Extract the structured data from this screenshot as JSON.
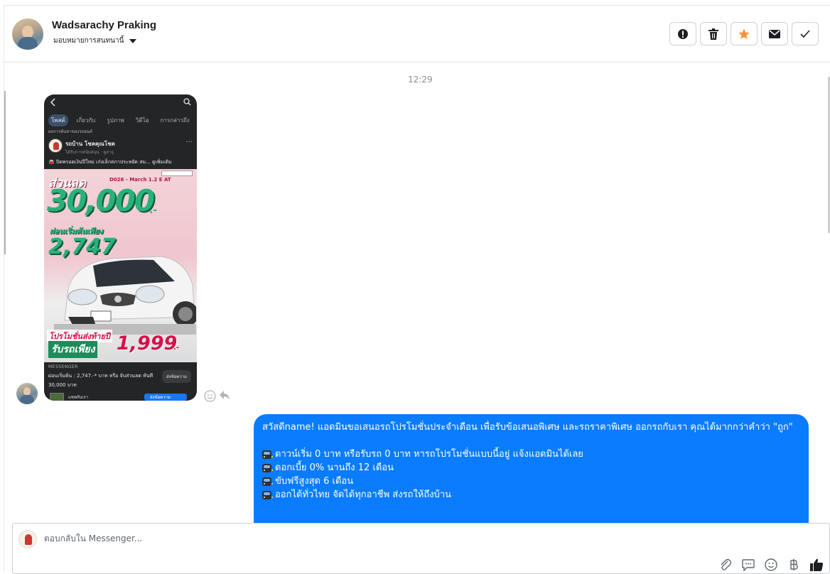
{
  "header": {
    "contact_name": "Wadsarachy Praking",
    "assign_label": "มอบหมายการสนทนานี้",
    "actions": [
      {
        "icon": "alert-icon"
      },
      {
        "icon": "trash-icon"
      },
      {
        "icon": "star-icon",
        "color": "#f7923a"
      },
      {
        "icon": "envelope-icon"
      },
      {
        "icon": "check-icon"
      }
    ]
  },
  "timestamp": "12:29",
  "incoming_post": {
    "tabs": [
      "โพสต์",
      "เกี่ยวกับ",
      "รูปภาพ",
      "วิดีโอ",
      "การกล่าวถึง"
    ],
    "subheader": "ผลการค้นหาของรถยนต์",
    "page_name": "รถบ้าน โชคคุณโชค",
    "page_meta": "ได้รับการสนับสนุน · ดูสาธุ",
    "caption": "🚘 ปิดพรอดเงินปีใหม่ เก๋งเล็กสภาประหยัด สม... ดูเพิ่มเติม",
    "ad": {
      "headline": "ส่วนลด",
      "code": "D026 - March 1.2 E AT",
      "discount": "30,000",
      "discount_suffix": ".-",
      "installment_label": "ผ่อนเริ่มต้นเพียง",
      "installment": "2,747",
      "promo_label": "โปรโมชั่นส่งท้ายปี",
      "pickup_label": "รับรถเพียง",
      "price": "1,999",
      "price_suffix": ".-"
    },
    "messenger_label": "MESSENGER",
    "messenger_text": "ผ่อนเริ่มต้น : 2,747.-* บาท หรือ จับส่วนลด ทันที 30,000 บาท",
    "send_button": "ส่งข้อความ",
    "bottom_name": "แชทกับเรา",
    "bottom_button": "ส่งข้อความ"
  },
  "outgoing_message": {
    "intro": "สวัสดีname! แอดมินขอเสนอรถโปรโมชั่นประจำเดือน เพื่อรับข้อเสนอพิเศษ และรถราคาพิเศษ ออกรถกับเรา คุณได้มากกว่าคำว่า \"ถูก\"",
    "lines": [
      "ดาวน์เริ่ม 0 บาท หรือรับรถ 0 บาท หารถโปรโมชั่นแบบนี้อยู่ แจ้งแอดมินได้เลย",
      "ดอกเบี้ย 0% นานถึง 12 เดือน",
      "ขับฟรีสูงสุด 6 เดือน",
      "ออกได้ทั่วไทย จัดได้ทุกอาชีพ ส่งรถให้ถึงบ้าน"
    ],
    "bubble_color": "#0a7cff"
  },
  "composer": {
    "placeholder": "ตอบกลับใน Messenger...",
    "tools": [
      "paperclip-icon",
      "chat-bubble-icon",
      "emoji-icon",
      "baht-icon",
      "thumbs-up-icon"
    ]
  }
}
